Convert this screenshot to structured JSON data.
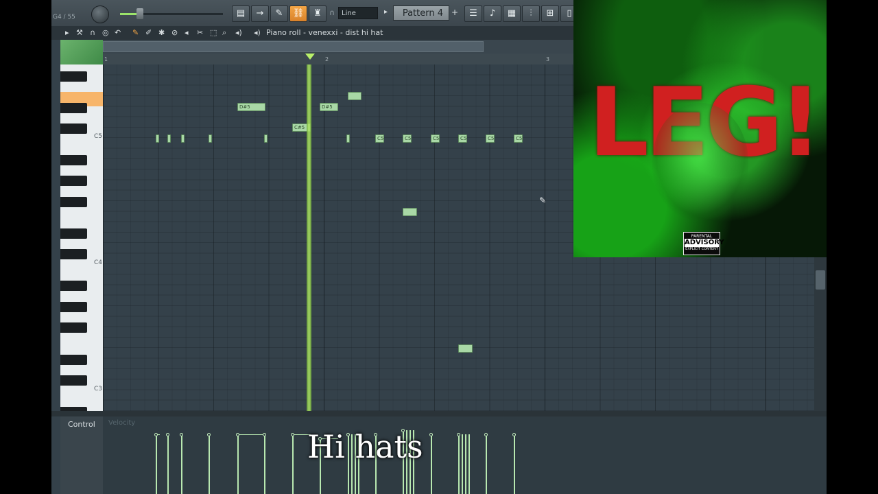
{
  "toolbar": {
    "voice_count": "G4 / 55",
    "snap": "Line",
    "pattern": "Pattern 4"
  },
  "piano_roll": {
    "title": "Piano roll - venexxi - dist hi hat",
    "bar_numbers": [
      "1",
      "2",
      "3"
    ],
    "key_labels": [
      "C5",
      "C4",
      "C3"
    ]
  },
  "notes": [
    {
      "label": "D#5"
    },
    {
      "label": "D#5"
    },
    {
      "label": "C#5"
    },
    {
      "label": "C5"
    },
    {
      "label": "C5"
    },
    {
      "label": "C5"
    },
    {
      "label": "C5"
    },
    {
      "label": "C5"
    },
    {
      "label": "C5"
    }
  ],
  "control": {
    "label": "Control",
    "target": "Velocity"
  },
  "album": {
    "title_word": "LEG!",
    "advisory_top": "PARENTAL",
    "advisory_mid": "ADVISORY",
    "advisory_bottom": "EXPLICIT CONTENT"
  },
  "caption": "Hi hats",
  "colors": {
    "accent": "#9be36a",
    "note": "#a9d8a6",
    "active_tool": "#f3a545",
    "highlight_key": "#f7b56a"
  }
}
